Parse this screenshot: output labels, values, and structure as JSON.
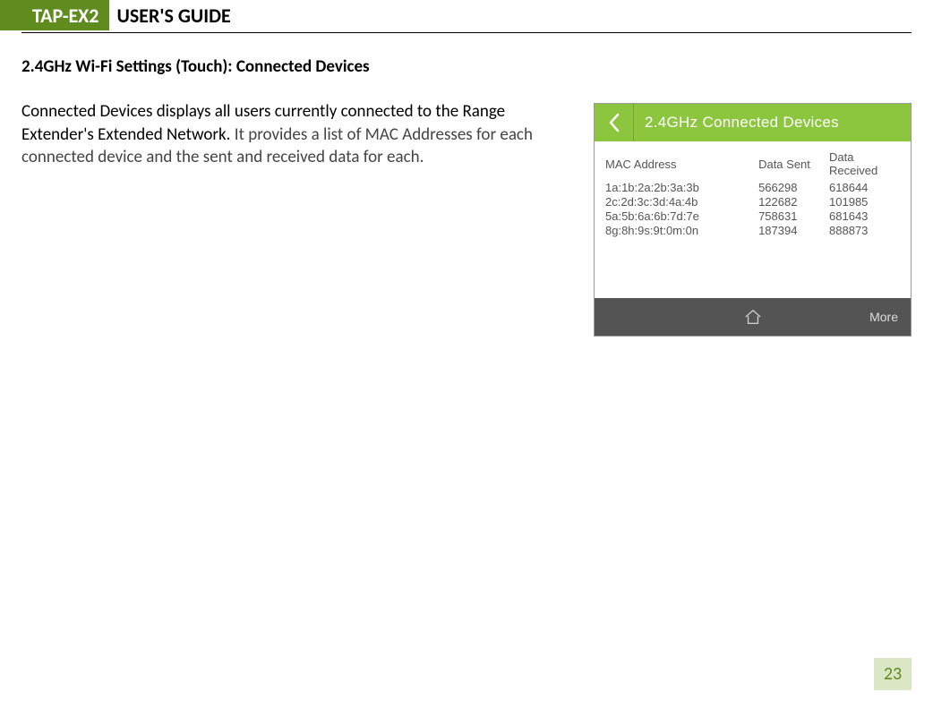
{
  "header": {
    "badge": "TAP-EX2",
    "title": "USER'S GUIDE"
  },
  "section": {
    "heading": "2.4GHz Wi-Fi Settings (Touch): Connected Devices",
    "body_dark": "Connected Devices displays all users currently connected to the Range Extender's Extended Network.",
    "body_light": " It provides a list of MAC Addresses for each connected device and the sent and received data for each."
  },
  "panel": {
    "title": "2.4GHz Connected Devices",
    "columns": {
      "mac": "MAC Address",
      "sent": "Data Sent",
      "recv": "Data Received"
    },
    "rows": [
      {
        "mac": "1a:1b:2a:2b:3a:3b",
        "sent": "566298",
        "recv": "618644"
      },
      {
        "mac": "2c:2d:3c:3d:4a:4b",
        "sent": "122682",
        "recv": "101985"
      },
      {
        "mac": "5a:5b:6a:6b:7d:7e",
        "sent": "758631",
        "recv": "681643"
      },
      {
        "mac": "8g:8h:9s:9t:0m:0n",
        "sent": "187394",
        "recv": "888873"
      }
    ],
    "more": "More"
  },
  "page_number": "23"
}
